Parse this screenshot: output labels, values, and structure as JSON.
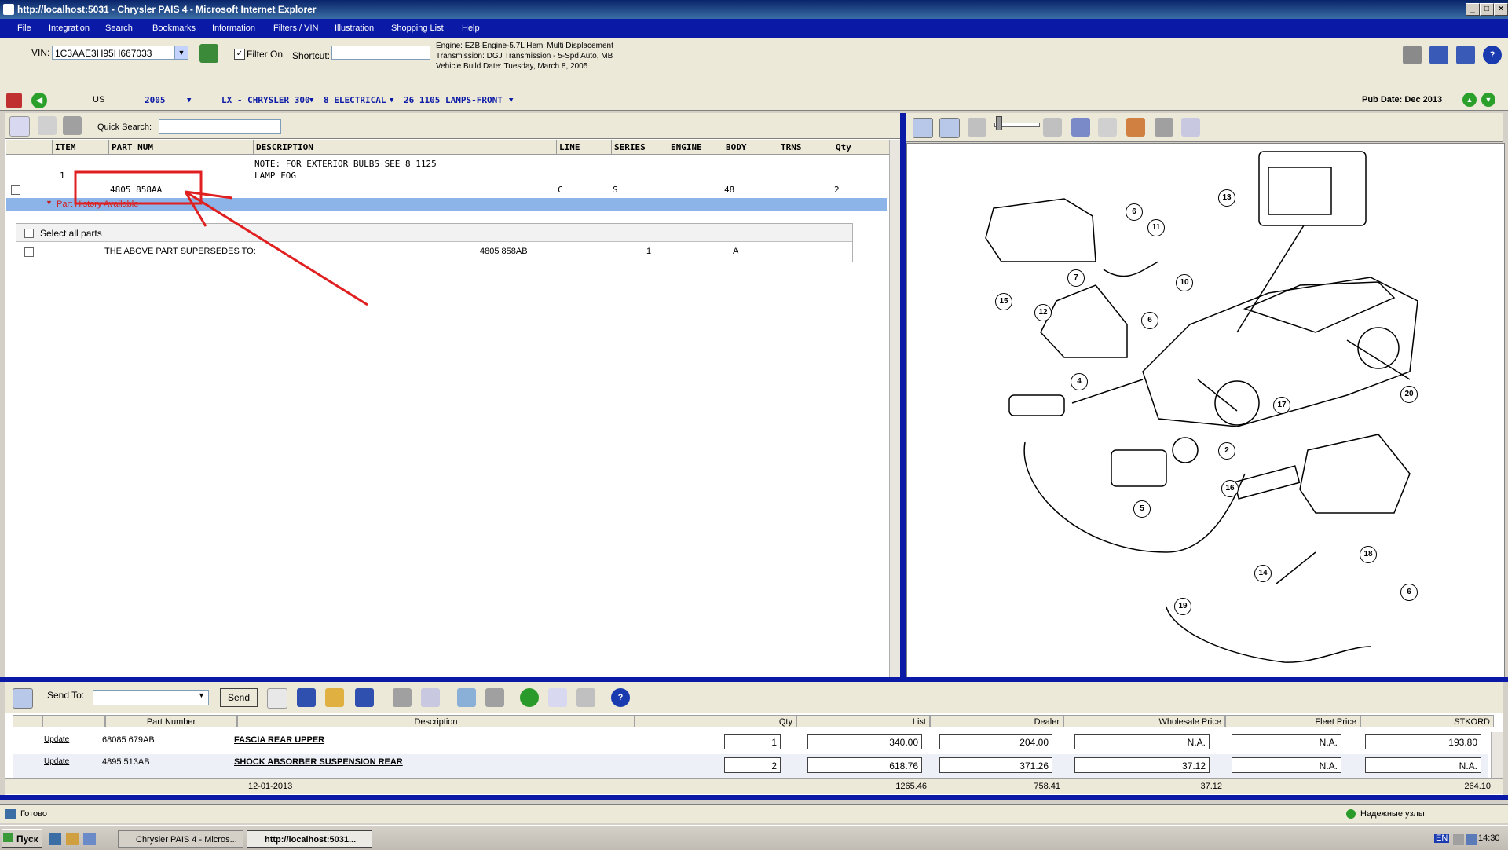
{
  "window": {
    "title": "http://localhost:5031 - Chrysler PAIS 4 - Microsoft Internet Explorer"
  },
  "menu": [
    "File",
    "Integration",
    "Search",
    "Bookmarks",
    "Information",
    "Filters / VIN",
    "Illustration",
    "Shopping List",
    "Help"
  ],
  "vin": {
    "label": "VIN:",
    "value": "1C3AAE3H95H667033",
    "filter_label": "Filter On",
    "shortcut_label": "Shortcut:",
    "shortcut_value": "",
    "engine": "Engine: EZB Engine-5.7L Hemi Multi Displacement",
    "transmission": "Transmission: DGJ Transmission - 5-Spd Auto, MB",
    "build_date": "Vehicle Build Date: Tuesday, March 8, 2005"
  },
  "nav": {
    "region": "US",
    "year": "2005",
    "model": "LX - CHRYSLER 300",
    "group": "8 ELECTRICAL",
    "figure": "26 1105 LAMPS-FRONT",
    "pub_date": "Pub Date: Dec 2013"
  },
  "left": {
    "quick_search_label": "Quick Search:",
    "headers": [
      "ITEM",
      "PART NUM",
      "DESCRIPTION",
      "LINE",
      "SERIES",
      "ENGINE",
      "BODY",
      "TRNS",
      "Qty"
    ],
    "note": "NOTE: FOR EXTERIOR BULBS SEE 8 1125",
    "item_num": "1",
    "item_desc": "LAMP FOG",
    "part": {
      "part_num": "4805 858AA",
      "line": "C",
      "series": "S",
      "body": "48",
      "qty": "2"
    },
    "history_label": "Part History Available",
    "select_all": "Select all parts",
    "supersedes": {
      "text": "THE ABOVE PART SUPERSEDES TO:",
      "part": "4805 858AB",
      "qty": "1",
      "code": "A"
    }
  },
  "callouts": [
    "13",
    "6",
    "11",
    "7",
    "10",
    "15",
    "12",
    "6",
    "4",
    "20",
    "17",
    "2",
    "16",
    "5",
    "14",
    "6",
    "18",
    "19"
  ],
  "cart": {
    "send_to_label": "Send To:",
    "send_label": "Send",
    "headers": [
      "Part Number",
      "Description",
      "Qty",
      "List",
      "Dealer",
      "Wholesale Price",
      "Fleet Price",
      "STKORD"
    ],
    "rows": [
      {
        "update": "Update",
        "part": "68085 679AB",
        "desc": "FASCIA REAR UPPER",
        "qty": "1",
        "list": "340.00",
        "dealer": "204.00",
        "wholesale": "N.A.",
        "fleet": "N.A.",
        "stkord": "193.80"
      },
      {
        "update": "Update",
        "part": "4895 513AB",
        "desc": "SHOCK ABSORBER SUSPENSION REAR",
        "qty": "2",
        "list": "618.76",
        "dealer": "371.26",
        "wholesale": "37.12",
        "fleet": "N.A.",
        "stkord": "N.A."
      }
    ],
    "totals": {
      "date": "12-01-2013",
      "list": "1265.46",
      "dealer": "758.41",
      "wholesale": "37.12",
      "stkord": "264.10"
    }
  },
  "status": {
    "left": "Готово",
    "zone": "Надежные узлы"
  },
  "taskbar": {
    "start": "Пуск",
    "tasks": [
      "Chrysler PAIS 4 - Micros...",
      "http://localhost:5031..."
    ],
    "lang": "EN",
    "clock": "14:30"
  },
  "colors": {
    "menu_bg": "#0b1aa6",
    "selection_row": "#8cb4e8",
    "annotation": "#e02020"
  }
}
